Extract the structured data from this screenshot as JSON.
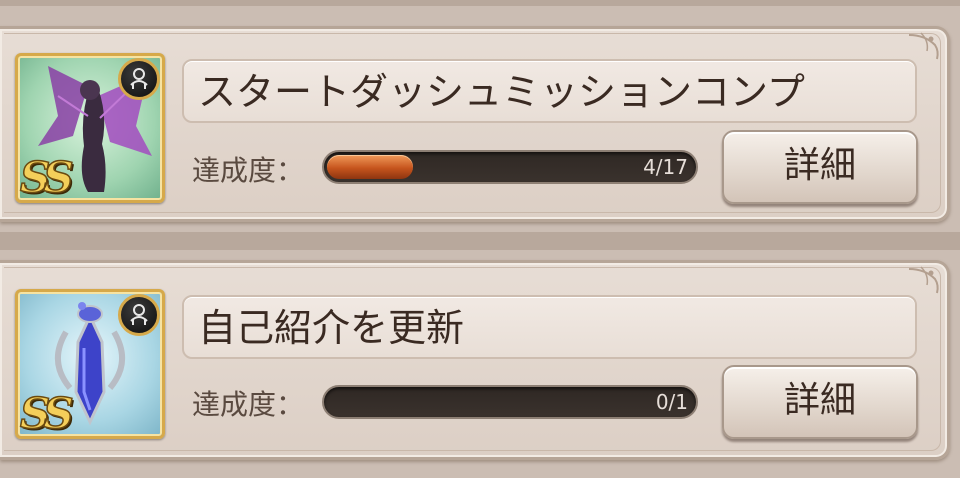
{
  "missions": [
    {
      "title": "スタートダッシュミッションコンプ",
      "progress_label": "達成度：",
      "progress_text": "4/17",
      "progress_fraction": 0.235,
      "detail_label": "詳細",
      "reward": {
        "rarity": "SS",
        "icon": "fairy-character-icon",
        "element_icon": "dark-element-icon"
      }
    },
    {
      "title": "自己紹介を更新",
      "progress_label": "達成度：",
      "progress_text": "0/1",
      "progress_fraction": 0.0,
      "detail_label": "詳細",
      "reward": {
        "rarity": "SS",
        "icon": "blue-potion-icon",
        "element_icon": "dark-element-icon"
      }
    }
  ],
  "colors": {
    "progress_fill": "#c6541d",
    "card_bg": "#e7ddd5",
    "rarity_gold": "#f4cf5a"
  }
}
